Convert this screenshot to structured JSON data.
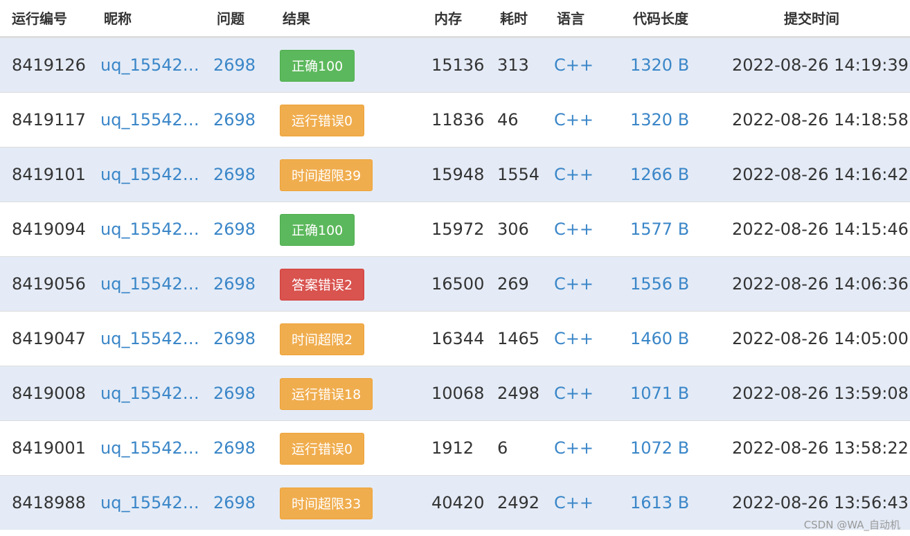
{
  "headers": {
    "run_id": "运行编号",
    "nickname": "昵称",
    "problem": "问题",
    "result": "结果",
    "memory": "内存",
    "time": "耗时",
    "language": "语言",
    "code_length": "代码长度",
    "submit_time": "提交时间"
  },
  "rows": [
    {
      "run_id": "8419126",
      "nickname": "uq_155420…",
      "problem": "2698",
      "result": "正确100",
      "status": "ok",
      "memory": "15136",
      "time": "313",
      "language": "C++",
      "code_length": "1320 B",
      "submit_time": "2022-08-26 14:19:39"
    },
    {
      "run_id": "8419117",
      "nickname": "uq_155420…",
      "problem": "2698",
      "result": "运行错误0",
      "status": "warn",
      "memory": "11836",
      "time": "46",
      "language": "C++",
      "code_length": "1320 B",
      "submit_time": "2022-08-26 14:18:58"
    },
    {
      "run_id": "8419101",
      "nickname": "uq_155420…",
      "problem": "2698",
      "result": "时间超限39",
      "status": "warn",
      "memory": "15948",
      "time": "1554",
      "language": "C++",
      "code_length": "1266 B",
      "submit_time": "2022-08-26 14:16:42"
    },
    {
      "run_id": "8419094",
      "nickname": "uq_155420…",
      "problem": "2698",
      "result": "正确100",
      "status": "ok",
      "memory": "15972",
      "time": "306",
      "language": "C++",
      "code_length": "1577 B",
      "submit_time": "2022-08-26 14:15:46"
    },
    {
      "run_id": "8419056",
      "nickname": "uq_155420…",
      "problem": "2698",
      "result": "答案错误2",
      "status": "err",
      "memory": "16500",
      "time": "269",
      "language": "C++",
      "code_length": "1556 B",
      "submit_time": "2022-08-26 14:06:36"
    },
    {
      "run_id": "8419047",
      "nickname": "uq_155420…",
      "problem": "2698",
      "result": "时间超限2",
      "status": "warn",
      "memory": "16344",
      "time": "1465",
      "language": "C++",
      "code_length": "1460 B",
      "submit_time": "2022-08-26 14:05:00"
    },
    {
      "run_id": "8419008",
      "nickname": "uq_155420…",
      "problem": "2698",
      "result": "运行错误18",
      "status": "warn",
      "memory": "10068",
      "time": "2498",
      "language": "C++",
      "code_length": "1071 B",
      "submit_time": "2022-08-26 13:59:08"
    },
    {
      "run_id": "8419001",
      "nickname": "uq_155420…",
      "problem": "2698",
      "result": "运行错误0",
      "status": "warn",
      "memory": "1912",
      "time": "6",
      "language": "C++",
      "code_length": "1072 B",
      "submit_time": "2022-08-26 13:58:22"
    },
    {
      "run_id": "8418988",
      "nickname": "uq_155420…",
      "problem": "2698",
      "result": "时间超限33",
      "status": "warn",
      "memory": "40420",
      "time": "2492",
      "language": "C++",
      "code_length": "1613 B",
      "submit_time": "2022-08-26 13:56:43"
    }
  ],
  "colors": {
    "ok": "#5cb85c",
    "warn": "#f0ad4e",
    "err": "#d9534f",
    "link": "#3a86c8",
    "stripe": "#e4ebf6"
  },
  "watermark": "CSDN @WA_自动机"
}
